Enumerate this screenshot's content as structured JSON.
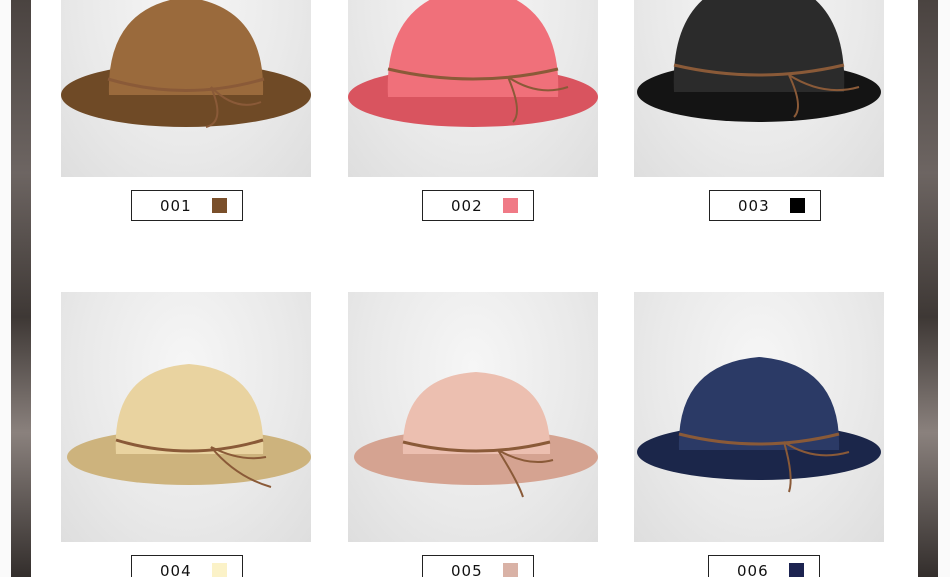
{
  "products": [
    {
      "code": "001",
      "swatch_color": "#7a4f2a",
      "hat_color": "#9a6a3c",
      "hat_dark": "#6f4a26"
    },
    {
      "code": "002",
      "swatch_color": "#f07a86",
      "hat_color": "#f0707a",
      "hat_dark": "#d9545f"
    },
    {
      "code": "003",
      "swatch_color": "#000000",
      "hat_color": "#2b2b2b",
      "hat_dark": "#141414"
    },
    {
      "code": "004",
      "swatch_color": "#fbf2c8",
      "hat_color": "#e9d3a0",
      "hat_dark": "#cdb37d"
    },
    {
      "code": "005",
      "swatch_color": "#d9b2a6",
      "hat_color": "#ecbfb0",
      "hat_dark": "#d5a391"
    },
    {
      "code": "006",
      "swatch_color": "#1c2350",
      "hat_color": "#2b3a66",
      "hat_dark": "#1b264a"
    }
  ],
  "colors": {
    "band": "#8a5a38",
    "label_border": "#222222"
  }
}
